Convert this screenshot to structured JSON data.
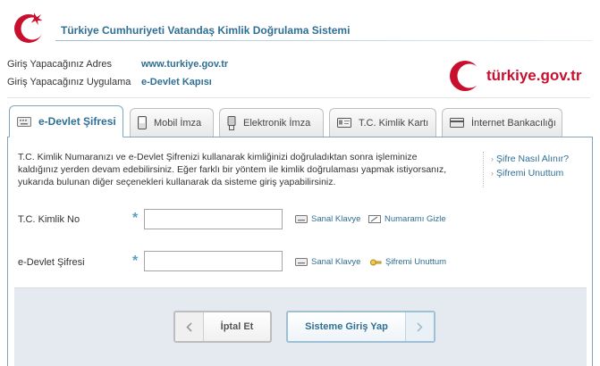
{
  "header": {
    "title": "Türkiye Cumhuriyeti Vatandaş Kimlik Doğrulama Sistemi"
  },
  "info": {
    "address_label": "Giriş Yapacağınız Adres",
    "address_value": "www.turkiye.gov.tr",
    "app_label": "Giriş Yapacağınız Uygulama",
    "app_value": "e-Devlet Kapısı"
  },
  "brand": {
    "text": "türkiye.gov.tr",
    "color": "#c8102e"
  },
  "tabs": [
    {
      "label": "e-Devlet Şifresi",
      "icon": "keyboard-icon",
      "active": true
    },
    {
      "label": "Mobil İmza",
      "icon": "mobile-phone-icon",
      "active": false
    },
    {
      "label": "Elektronik İmza",
      "icon": "usb-token-icon",
      "active": false
    },
    {
      "label": "T.C. Kimlik Kartı",
      "icon": "id-card-icon",
      "active": false
    },
    {
      "label": "İnternet Bankacılığı",
      "icon": "bank-card-icon",
      "active": false
    }
  ],
  "intro": "T.C. Kimlik Numaranızı ve e-Devlet Şifrenizi kullanarak kimliğinizi doğruladıktan sonra işleminize kaldığınız yerden devam edebilirsiniz. Eğer farklı bir yöntem ile kimlik doğrulaması yapmak istiyorsanız, yukarıda bulunan diğer seçenekleri kullanarak da sisteme giriş yapabilirsiniz.",
  "help_links": [
    "Şifre Nasıl Alınır?",
    "Şifremi Unuttum"
  ],
  "form": {
    "tckn": {
      "label": "T.C. Kimlik No",
      "value": "",
      "keyboard": "Sanal Klavye",
      "hide": "Numaramı Gizle"
    },
    "password": {
      "label": "e-Devlet Şifresi",
      "value": "",
      "keyboard": "Sanal Klavye",
      "forgot": "Şifremi Unuttum"
    }
  },
  "buttons": {
    "cancel": "İptal Et",
    "login": "Sisteme Giriş Yap"
  },
  "colors": {
    "accent": "#2f6f94",
    "brand_red": "#c8102e",
    "asterisk": "#5f9cc2"
  }
}
